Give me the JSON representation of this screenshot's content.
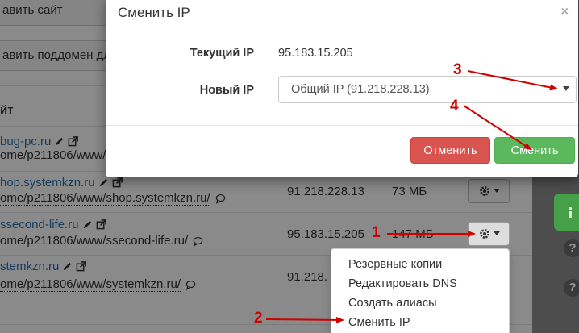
{
  "background": {
    "top_button_1": "авить сайт",
    "top_button_2": "авить поддомен для",
    "column_header": "йт",
    "rows": [
      {
        "name": "bug-pc.ru",
        "path": "ome/p211806/www/",
        "ip": "",
        "size": ""
      },
      {
        "name": "hop.systemkzn.ru",
        "path": "ome/p211806/www/shop.systemkzn.ru/",
        "ip": "91.218.228.13",
        "size": "73 МБ"
      },
      {
        "name": "ssecond-life.ru",
        "path": "ome/p211806/www/ssecond-life.ru/",
        "ip": "95.183.15.205",
        "size": "147 МБ"
      },
      {
        "name": "stemkzn.ru",
        "path": "ome/p211806/www/systemkzn.ru/",
        "ip": "91.218.",
        "size": ""
      }
    ]
  },
  "dropdown_menu": {
    "items": [
      "Резервные копии",
      "Редактировать DNS",
      "Создать алиасы",
      "Сменить IP"
    ]
  },
  "modal": {
    "title": "Сменить IP",
    "close": "×",
    "current_ip_label": "Текущий IP",
    "current_ip_value": "95.183.15.205",
    "new_ip_label": "Новый IP",
    "new_ip_selected": "Общий IP (91.218.228.13)",
    "cancel_label": "Отменить",
    "submit_label": "Сменить"
  },
  "sidebar_right": {
    "help_icon": "?"
  },
  "annotations": {
    "step_1": "1",
    "step_2": "2",
    "step_3": "3",
    "step_4": "4"
  },
  "colors": {
    "link": "#2a6fb0",
    "danger": "#d9534f",
    "success": "#5cb85c",
    "annotation": "#d00000"
  }
}
